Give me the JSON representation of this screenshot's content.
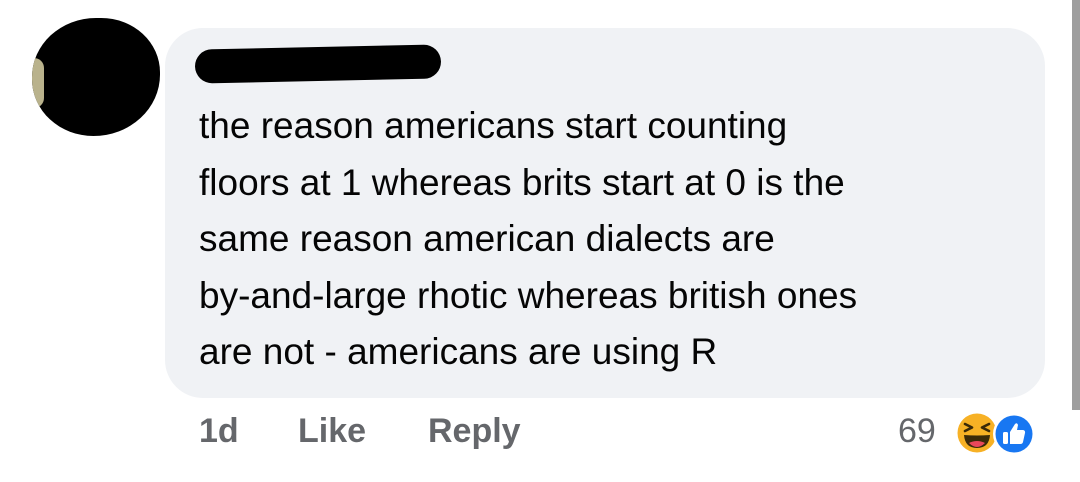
{
  "comment": {
    "lines": [
      "the reason americans start counting",
      "floors at 1 whereas brits start at 0 is the",
      "same reason american dialects are",
      "by-and-large rhotic whereas british ones",
      "are not - americans are using R"
    ]
  },
  "actions": {
    "time": "1d",
    "like_label": "Like",
    "reply_label": "Reply"
  },
  "reactions": {
    "count": "69",
    "icons": [
      "haha-icon",
      "like-icon"
    ]
  },
  "colors": {
    "bubble": "#f0f2f5",
    "action_text": "#65676b",
    "like_blue": "#1877f2",
    "haha_yellow": "#f7b125"
  }
}
